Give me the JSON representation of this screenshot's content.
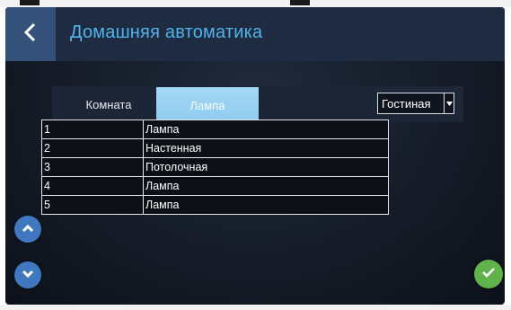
{
  "header": {
    "title": "Домашняя автоматика",
    "back_icon": "chevron-left-icon"
  },
  "tabs": {
    "room_label": "Комната",
    "lamp_label": "Лампа",
    "active": "Лампа"
  },
  "room_select": {
    "value": "Гостиная",
    "arrow_icon": "caret-down-icon"
  },
  "table": {
    "rows": [
      {
        "num": "1",
        "name": "Лампа"
      },
      {
        "num": "2",
        "name": "Настенная"
      },
      {
        "num": "3",
        "name": "Потолочная"
      },
      {
        "num": "4",
        "name": "Лампа"
      },
      {
        "num": "5",
        "name": "Лампа"
      }
    ]
  },
  "nav": {
    "up_icon": "chevron-up-icon",
    "down_icon": "chevron-down-icon",
    "ok_icon": "checkmark-icon"
  },
  "colors": {
    "title": "#4fb3ec",
    "back_button": "#34517a",
    "active_tab": "#a5d8f6",
    "nav_button": "#3f78c0",
    "ok_button": "#5fb34a"
  }
}
